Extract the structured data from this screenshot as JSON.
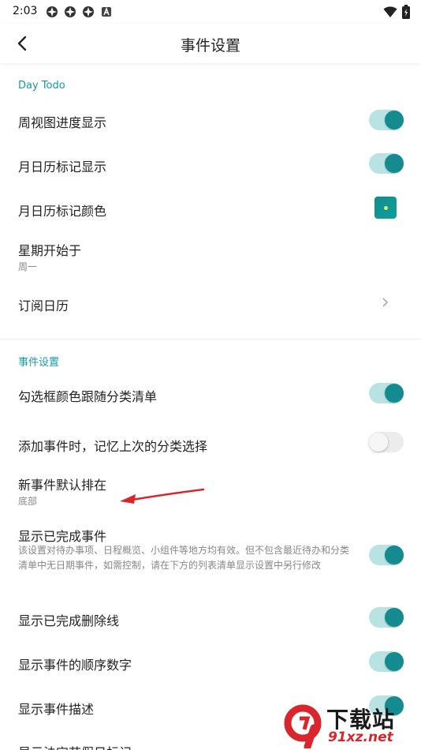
{
  "status_bar": {
    "time": "2:03",
    "notification_icons": [
      "app-icon",
      "app-icon",
      "app-icon",
      "letter-a-icon"
    ],
    "right_icons": [
      "wifi-icon",
      "battery-icon"
    ]
  },
  "app_bar": {
    "back_icon": "back-arrow-icon",
    "title": "事件设置"
  },
  "sections": {
    "day_todo": {
      "header": "Day Todo",
      "week_progress": {
        "label": "周视图进度显示",
        "enabled": true
      },
      "month_marker": {
        "label": "月日历标记显示",
        "enabled": true
      },
      "month_marker_color": {
        "label": "月日历标记颜色",
        "color": "#138b8f"
      },
      "week_start": {
        "label": "星期开始于",
        "value": "周一"
      },
      "subscribe_calendar": {
        "label": "订阅日历"
      }
    },
    "event_settings": {
      "header": "事件设置",
      "checkbox_color": {
        "label": "勾选框颜色跟随分类清单",
        "enabled": true
      },
      "remember_category": {
        "label": "添加事件时，记忆上次的分类选择",
        "enabled": false
      },
      "new_event_position": {
        "label": "新事件默认排在",
        "value": "底部"
      },
      "show_completed": {
        "label": "显示已完成事件",
        "description": "该设置对待办事项、日程概览、小组件等地方均有效。但不包含最近待办和分类清单中无日期事件，如需控制，请在下方的列表清单显示设置中另行修改",
        "enabled": true
      },
      "strikethrough": {
        "label": "显示已完成删除线",
        "enabled": true
      },
      "order_numbers": {
        "label": "显示事件的顺序数字",
        "enabled": true
      },
      "description_row": {
        "label": "显示事件描述",
        "enabled": true
      },
      "holiday_row": {
        "label": "显示法定节假日标记"
      }
    }
  },
  "colors": {
    "accent": "#138b8f",
    "toggle_track_on": "#b9e3e2",
    "section_header": "#159aa3",
    "annotation_arrow": "#d8262c"
  },
  "watermark": {
    "text": "下载站",
    "url": "91xz.net"
  }
}
